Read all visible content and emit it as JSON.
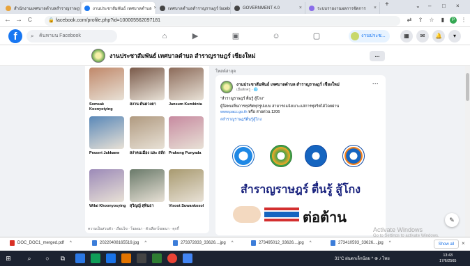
{
  "browser": {
    "tabs": [
      {
        "title": "สำนักงานเทศบาลตำบลสำราญราษฎร์",
        "icon_color": "#e8a33b",
        "active": false
      },
      {
        "title": "งานประชาสัมพันธ์ เทศบาลตำบล",
        "icon_color": "#1877f2",
        "active": true
      },
      {
        "title": "เทศบาลตำบลสำราญราษฎร์ facebook",
        "icon_color": "#444444",
        "active": false
      },
      {
        "title": "GOVERNMENT 4.0",
        "icon_color": "#444444",
        "active": false
      },
      {
        "title": "ระบบรายงานผลการจัดการ",
        "icon_color": "#8a6de9",
        "active": false
      }
    ],
    "new_tab": "+",
    "window_buttons": [
      "⌄",
      "–",
      "□",
      "×"
    ],
    "nav": {
      "back": "←",
      "forward": "→",
      "reload": "C",
      "home": "⌂"
    },
    "url": "facebook.com/profile.php?id=100005562097181",
    "profile_initial": "P"
  },
  "facebook": {
    "logo": "f",
    "search_placeholder": "ค้นหาบน Facebook",
    "page_chip": "งานประช...",
    "page_title": "งานประชาสัมพันธ์ เทศบาลตำบล สำราญราษฎร์ เชียงใหม่",
    "more_button": "...",
    "friends": [
      {
        "name": "Somsak Koonyotying",
        "color": "#c0886a"
      },
      {
        "name": "สงวน ต้นดวงตา",
        "color": "#7a5a4a"
      },
      {
        "name": "Jansum Kumbinta",
        "color": "#8c6b5a"
      },
      {
        "name": "Prasert Jakkaew",
        "color": "#5a88b8"
      },
      {
        "name": "สง่าคนเมือง และ สลัก",
        "color": "#b09a80"
      },
      {
        "name": "Prakong Punyada",
        "color": "#c78aa0"
      },
      {
        "name": "Wilai Khoonyosying",
        "color": "#9c8ab8"
      },
      {
        "name": "สุวิญญ์ สุทินธา",
        "color": "#6a7a6a"
      },
      {
        "name": "Visoot Suwankosol",
        "color": "#a89a70"
      }
    ],
    "friends_footer": "ความเป็นส่วนตัว · เงื่อนไข · โฆษณา · ตัวเลือกโฆษณา · คุกกี้",
    "feed_header": "โพสต์ล่าสุด",
    "post": {
      "author": "งานประชาสัมพันธ์ เทศบาลตำบล สำราญราษฎร์ เชียงใหม่",
      "time": "เมื่อสักครู่ · 🌐",
      "line1": "\"สำราญราษฎร์ ตื่นรู้ สู้โกง\"",
      "line2": "ผู้ใดพบเห็นการทุจริตทุกรูปแบบ สามารถแจ้งเบาะแสการทุจริตได้โดยผ่าน",
      "link": "www.pacc.go.th",
      "line3": " หรือ สายด่วน 1206",
      "hashtag": "#สำราญราษฎร์ตื่นรู้สู้โกง",
      "image_title": "สำราญราษฎร์ ตื่นรู้ สู้โกง",
      "image_subtitle": "ต่อต้าน"
    },
    "watermark_title": "Activate Windows",
    "watermark_sub": "Go to Settings to activate Windows."
  },
  "downloads": {
    "items": [
      {
        "name": "DOC_DOC1_merged.pdf",
        "color": "#d93025"
      },
      {
        "name": "20220408165519.jpg",
        "color": "#3c7dd9"
      },
      {
        "name": "273372833_33626....jpg",
        "color": "#3c7dd9"
      },
      {
        "name": "273495012_33626....jpg",
        "color": "#3c7dd9"
      },
      {
        "name": "273410593_33626....jpg",
        "color": "#3c7dd9"
      }
    ],
    "caret": "^",
    "show_all": "Show all",
    "close": "×"
  },
  "taskbar": {
    "start": "⊞",
    "tray_text": "31°C  ฝนตกเล็กน้อย  ^  ⊕  ♪  ไทย",
    "time": "13:43",
    "date": "17/6/2565"
  }
}
